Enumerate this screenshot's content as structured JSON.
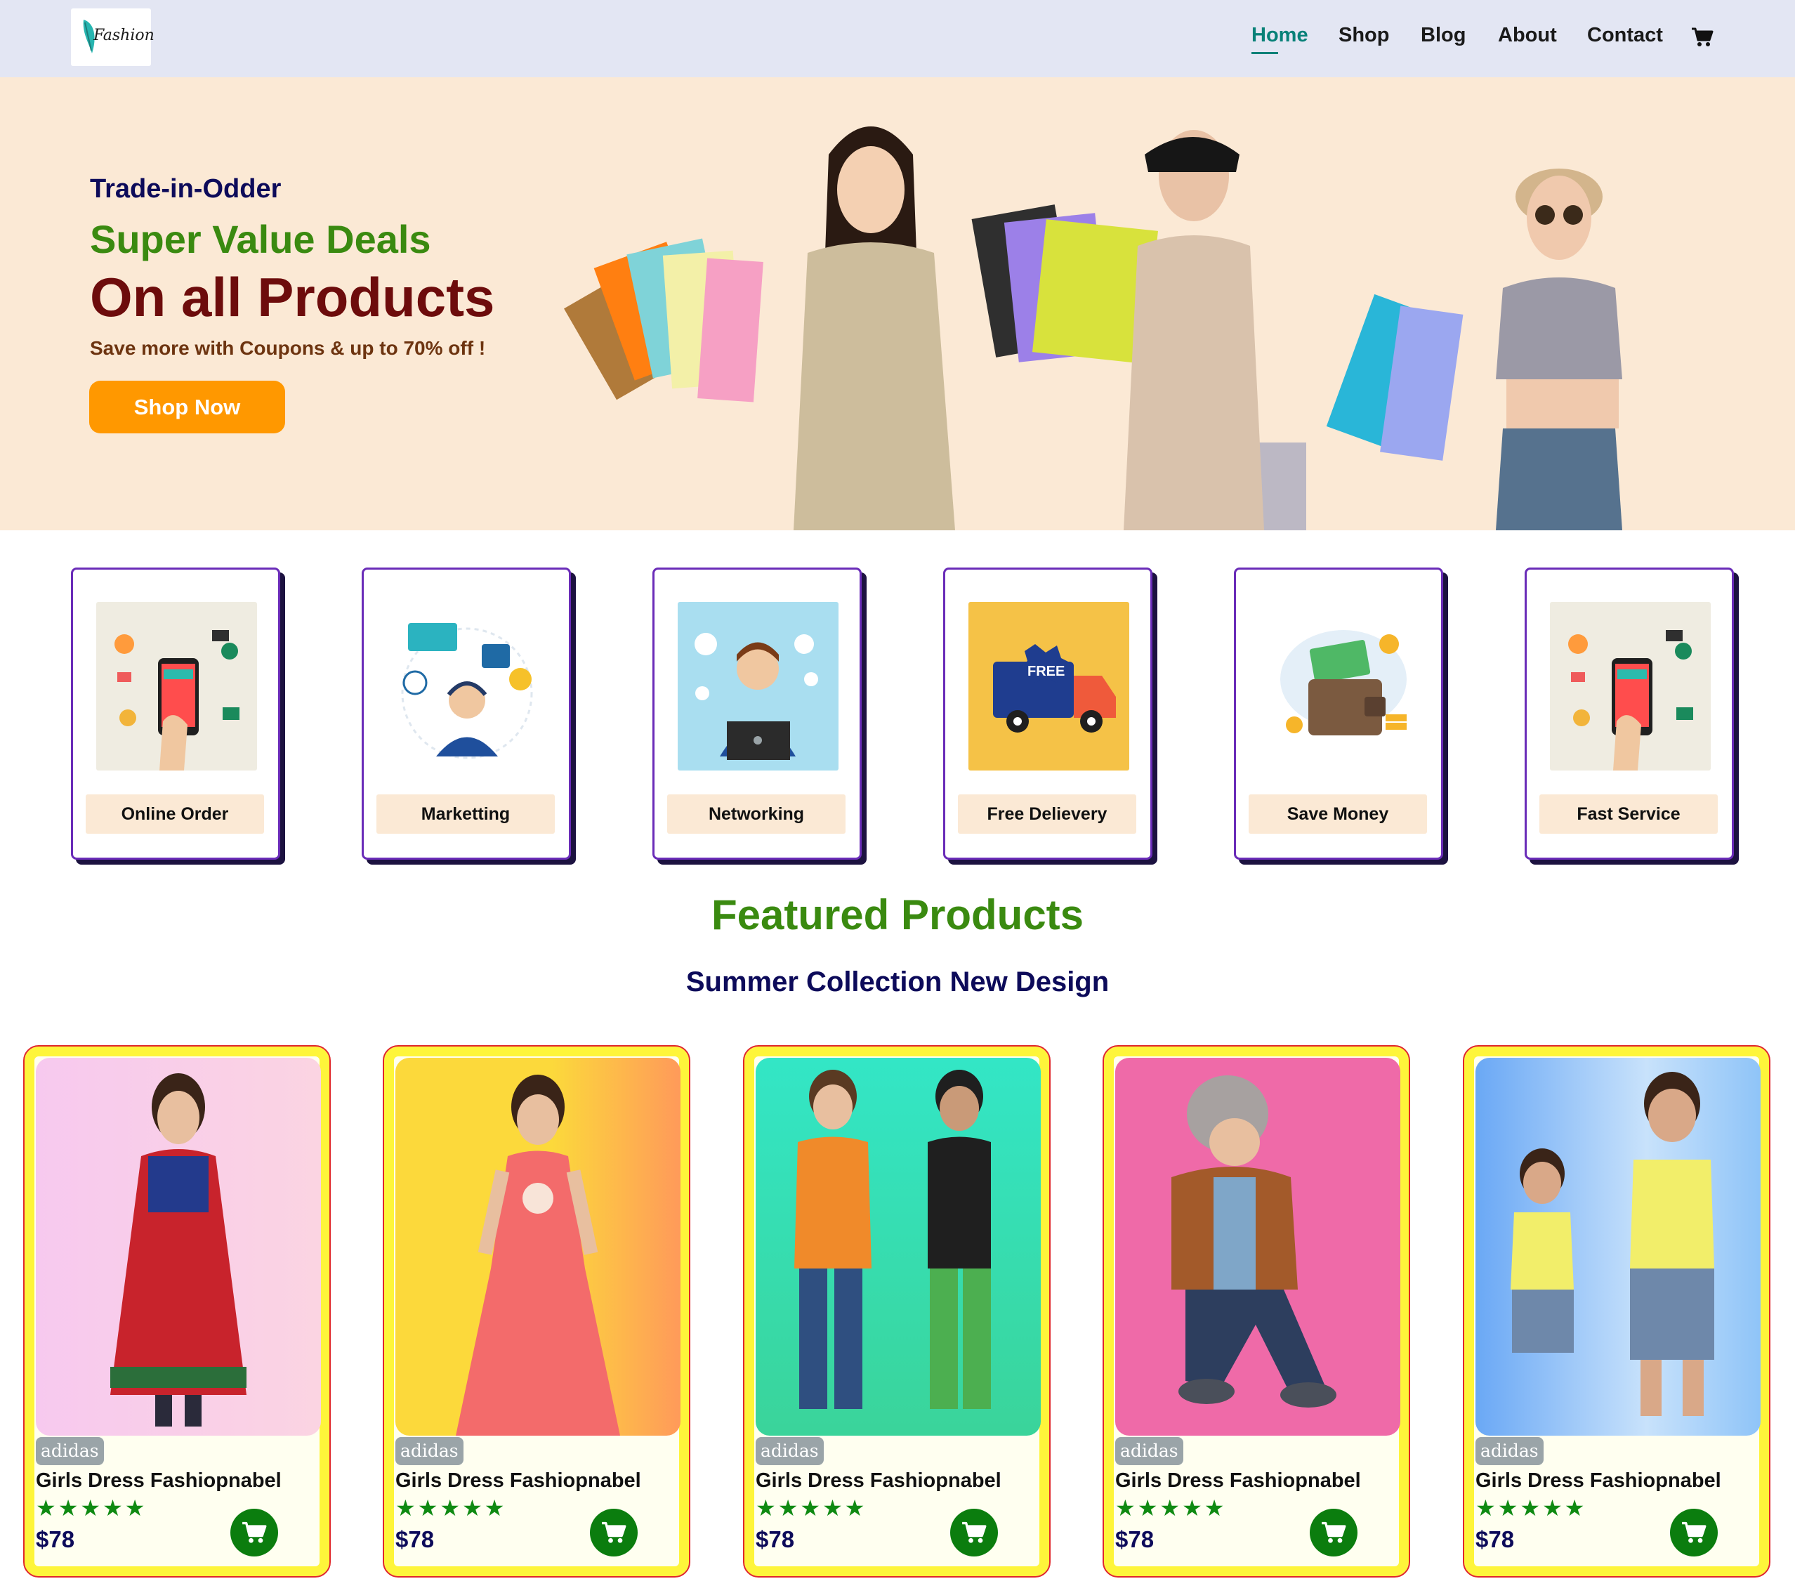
{
  "header": {
    "logo_text": "Fashion",
    "nav": [
      {
        "label": "Home",
        "active": true
      },
      {
        "label": "Shop",
        "active": false
      },
      {
        "label": "Blog",
        "active": false
      },
      {
        "label": "About",
        "active": false
      },
      {
        "label": "Contact",
        "active": false
      }
    ],
    "cart_icon": "shopping-cart-icon"
  },
  "hero": {
    "kicker": "Trade-in-Odder",
    "headline": "Super Value Deals",
    "title": "On all Products",
    "subtitle": "Save more with Coupons & up to 70% off !",
    "button": "Shop Now"
  },
  "features": [
    {
      "label": "Online Order",
      "icon": "mobile-shopping-illustration"
    },
    {
      "label": "Marketting",
      "icon": "customer-support-illustration"
    },
    {
      "label": "Networking",
      "icon": "support-agent-laptop-illustration"
    },
    {
      "label": "Free Delievery",
      "icon": "free-delivery-truck-illustration"
    },
    {
      "label": "Save Money",
      "icon": "wallet-money-illustration"
    },
    {
      "label": "Fast Service",
      "icon": "mobile-shopping-illustration"
    }
  ],
  "featured": {
    "title": "Featured Products",
    "subtitle": "Summer Collection New Design"
  },
  "products": [
    {
      "brand": "adidas",
      "name": "Girls Dress Fashiopnabel",
      "rating": 5,
      "price": "$78",
      "stars": "★★★★★"
    },
    {
      "brand": "adidas",
      "name": "Girls Dress Fashiopnabel",
      "rating": 5,
      "price": "$78",
      "stars": "★★★★★"
    },
    {
      "brand": "adidas",
      "name": "Girls Dress Fashiopnabel",
      "rating": 5,
      "price": "$78",
      "stars": "★★★★★"
    },
    {
      "brand": "adidas",
      "name": "Girls Dress Fashiopnabel",
      "rating": 5,
      "price": "$78",
      "stars": "★★★★★"
    },
    {
      "brand": "adidas",
      "name": "Girls Dress Fashiopnabel",
      "rating": 5,
      "price": "$78",
      "stars": "★★★★★"
    }
  ],
  "colors": {
    "header_bg": "#e3e6f3",
    "hero_bg": "#fbe9d5",
    "accent_green": "#3a8a10",
    "nav_active": "#088178",
    "button_orange": "#ff9800",
    "dark_navy": "#0d0b5a",
    "cart_green": "#0b7d0e"
  }
}
